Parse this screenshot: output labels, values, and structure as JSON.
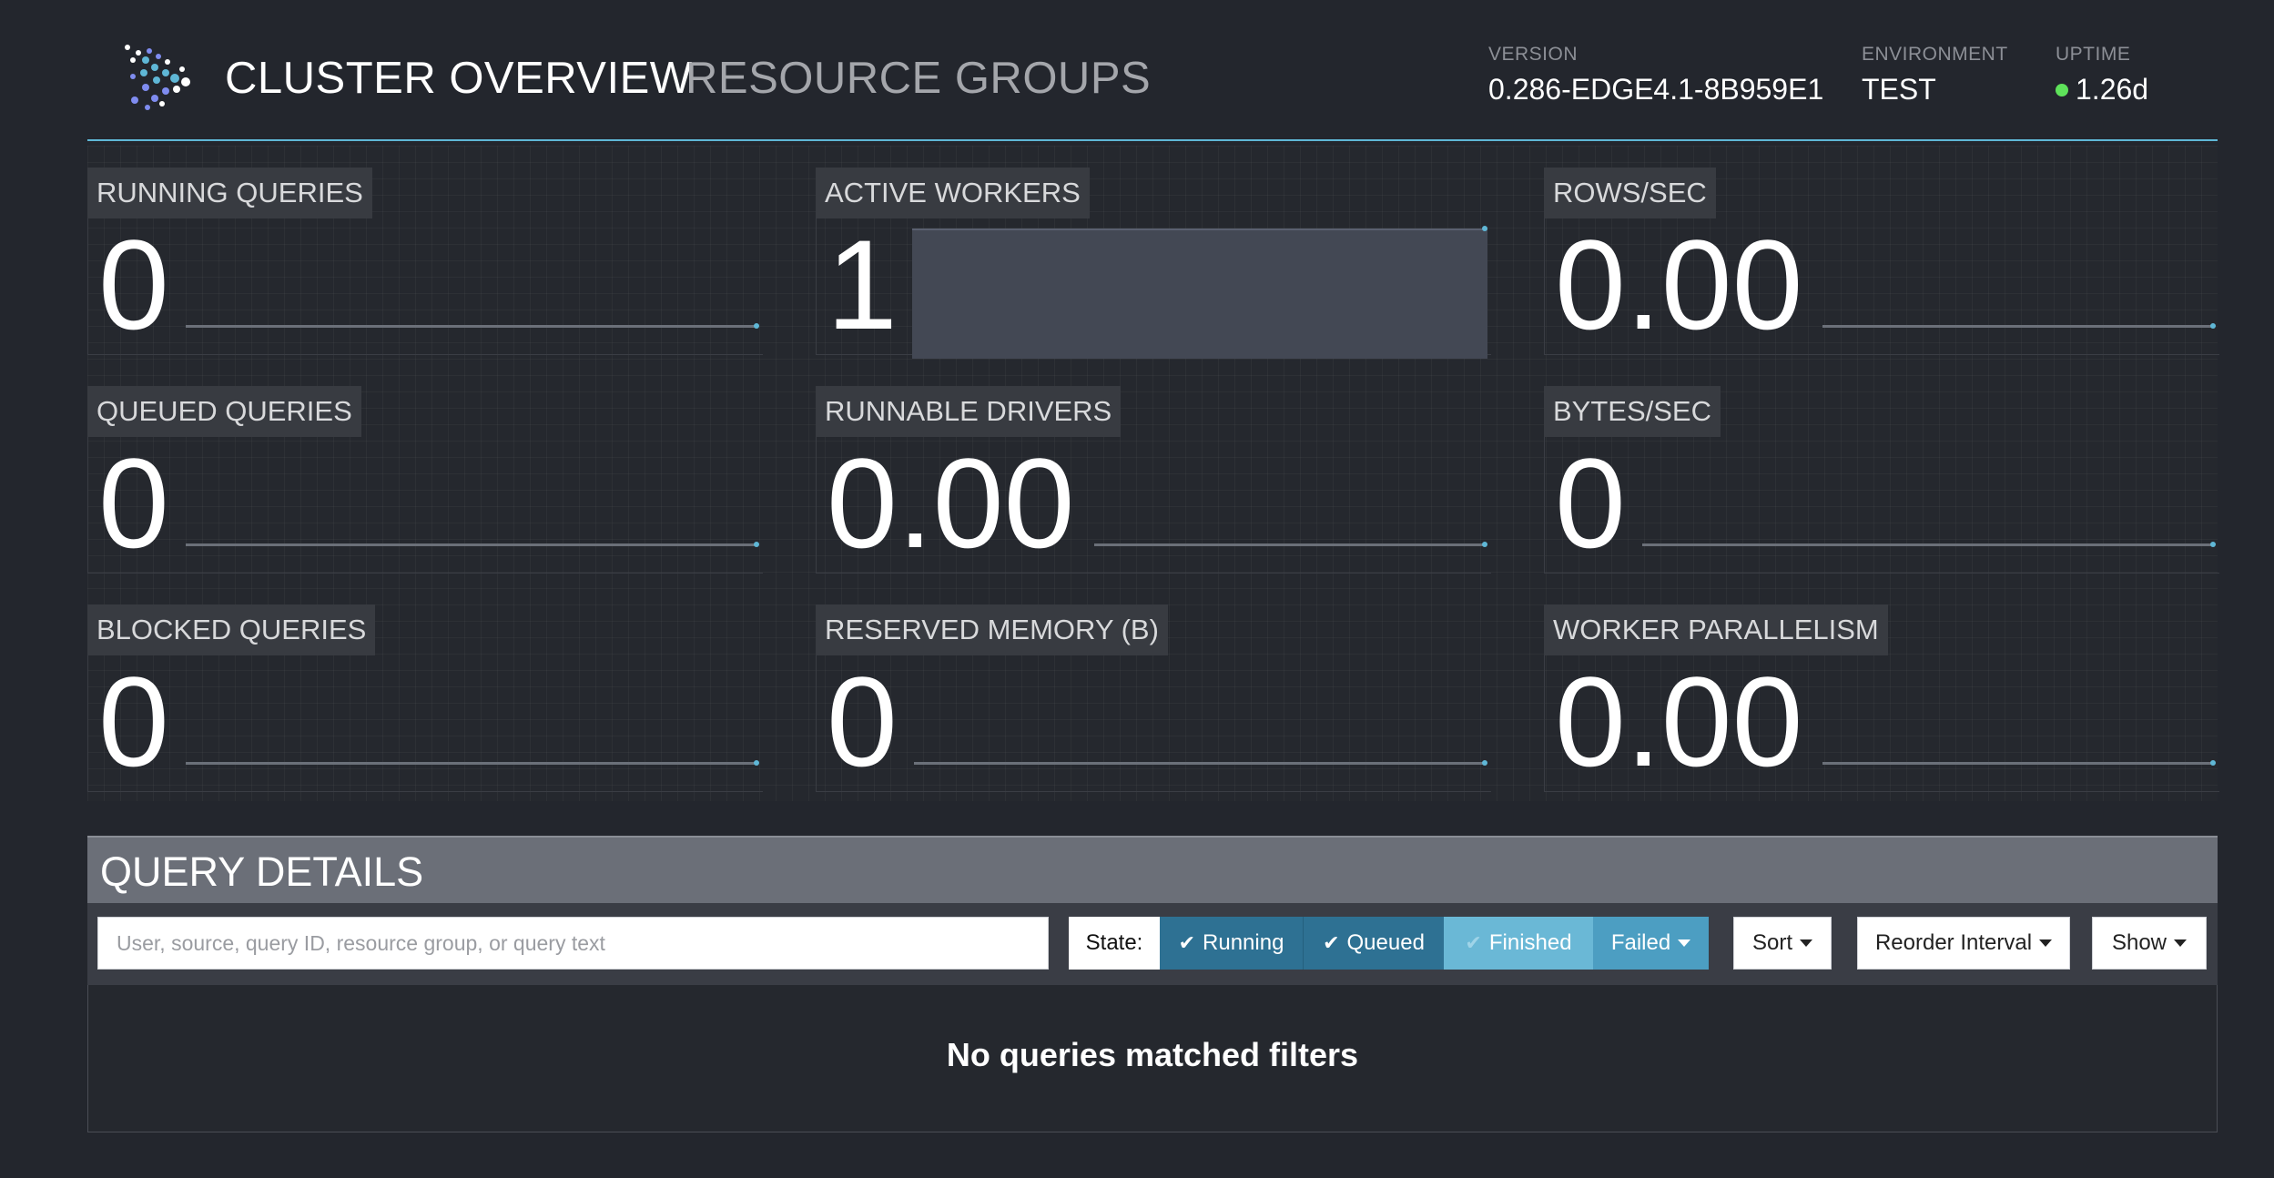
{
  "header": {
    "nav": [
      "CLUSTER OVERVIEW",
      "RESOURCE GROUPS"
    ],
    "version": {
      "label": "VERSION",
      "value": "0.286-EDGE4.1-8B959E1"
    },
    "environment": {
      "label": "ENVIRONMENT",
      "value": "TEST"
    },
    "uptime": {
      "label": "UPTIME",
      "value": "1.26d",
      "status_color": "#5ee25a"
    }
  },
  "stats": [
    {
      "label": "RUNNING QUERIES",
      "value": "0"
    },
    {
      "label": "ACTIVE WORKERS",
      "value": "1"
    },
    {
      "label": "ROWS/SEC",
      "value": "0.00"
    },
    {
      "label": "QUEUED QUERIES",
      "value": "0"
    },
    {
      "label": "RUNNABLE DRIVERS",
      "value": "0.00"
    },
    {
      "label": "BYTES/SEC",
      "value": "0"
    },
    {
      "label": "BLOCKED QUERIES",
      "value": "0"
    },
    {
      "label": "RESERVED MEMORY (B)",
      "value": "0"
    },
    {
      "label": "WORKER PARALLELISM",
      "value": "0.00"
    }
  ],
  "query_details": {
    "title": "QUERY DETAILS",
    "search_placeholder": "User, source, query ID, resource group, or query text",
    "state_label": "State:",
    "states": [
      {
        "label": "Running",
        "checked": true
      },
      {
        "label": "Queued",
        "checked": true
      },
      {
        "label": "Finished",
        "checked": false
      },
      {
        "label": "Failed",
        "checked": false
      }
    ],
    "sort_label": "Sort",
    "reorder_label": "Reorder Interval",
    "show_label": "Show",
    "empty_message": "No queries matched filters"
  },
  "colors": {
    "background": "#23262d",
    "accent": "#5fb7d6",
    "state_active": "#2e7193",
    "state_inactive": "#6ab8d6"
  }
}
